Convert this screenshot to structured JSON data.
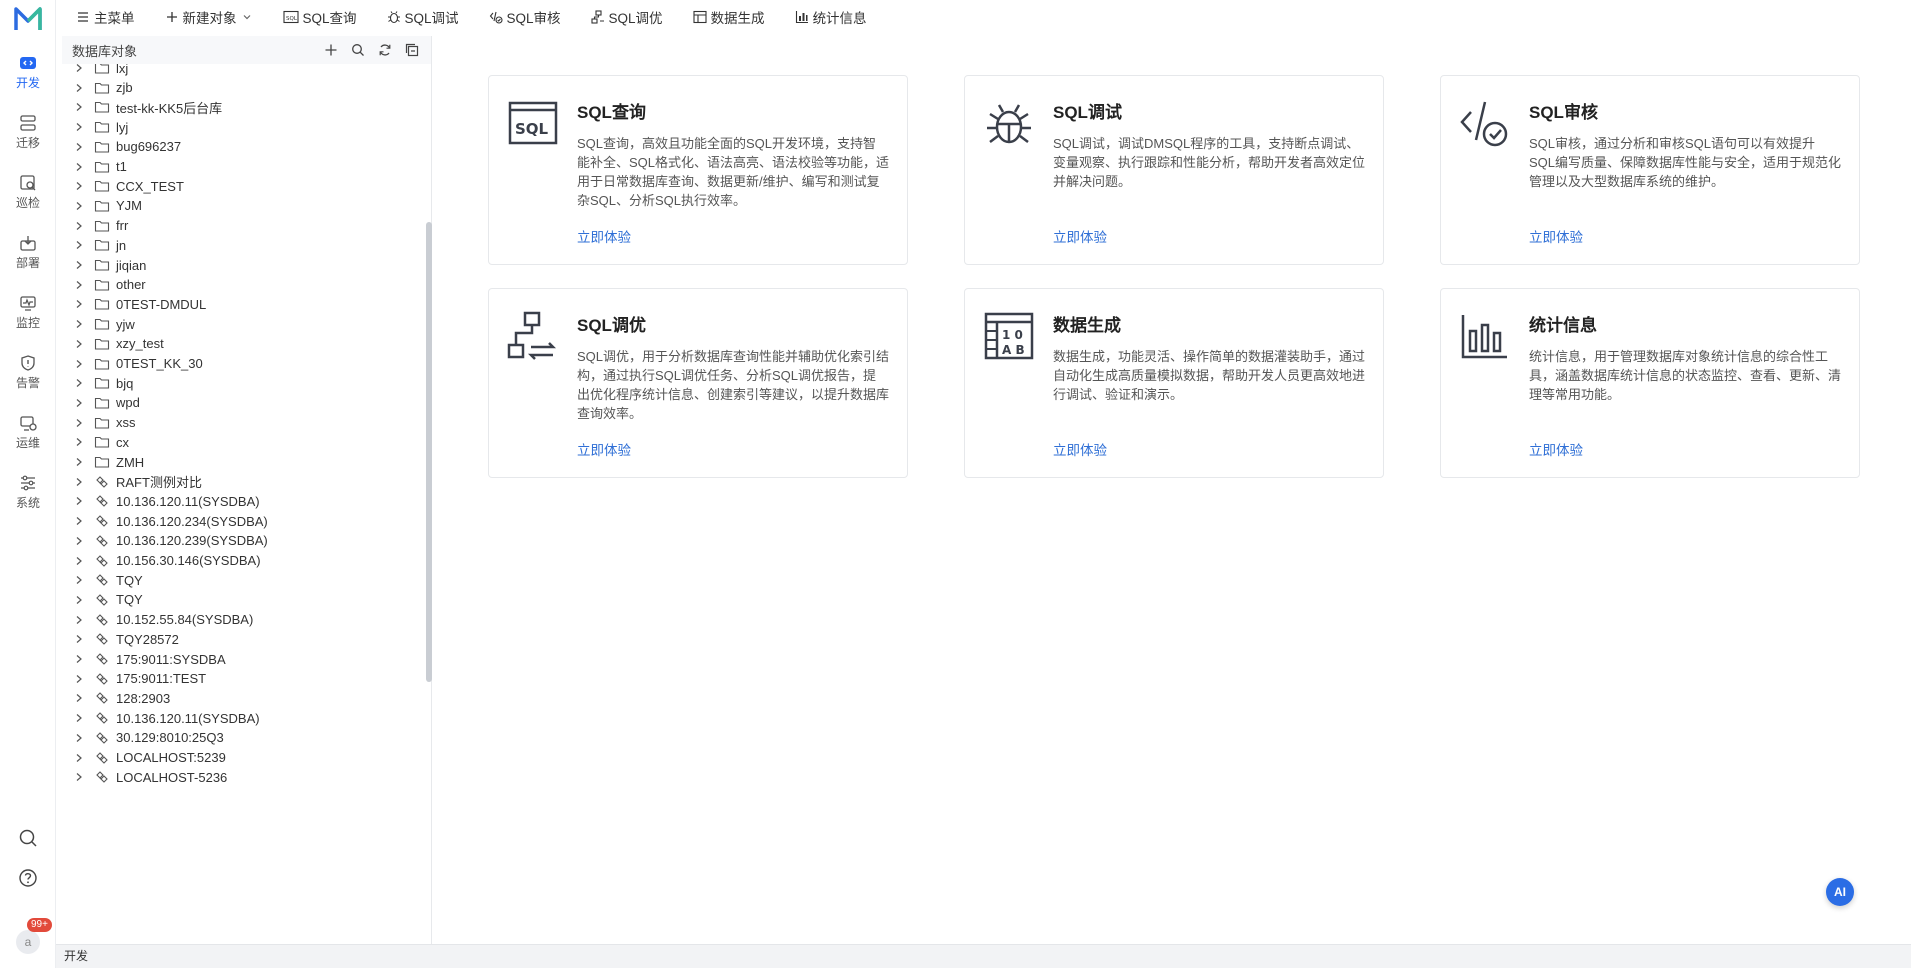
{
  "colors": {
    "accent": "#2468f2",
    "link": "#2f6fd6",
    "badge": "#e24a3b"
  },
  "rail": {
    "items": [
      {
        "label": "开发",
        "icon": "code-icon",
        "active": true
      },
      {
        "label": "迁移",
        "icon": "migrate-icon"
      },
      {
        "label": "巡检",
        "icon": "inspect-icon"
      },
      {
        "label": "部署",
        "icon": "deploy-icon"
      },
      {
        "label": "监控",
        "icon": "monitor-icon"
      },
      {
        "label": "告警",
        "icon": "alert-icon"
      },
      {
        "label": "运维",
        "icon": "ops-icon"
      },
      {
        "label": "系统",
        "icon": "system-icon"
      }
    ],
    "avatar": "a",
    "badge": "99+"
  },
  "toolbar": {
    "items": [
      {
        "label": "主菜单",
        "icon": "menu-icon"
      },
      {
        "label": "新建对象",
        "icon": "plus-icon"
      },
      {
        "label": "SQL查询",
        "icon": "sql-icon"
      },
      {
        "label": "SQL调试",
        "icon": "bug-icon"
      },
      {
        "label": "SQL审核",
        "icon": "audit-icon"
      },
      {
        "label": "SQL调优",
        "icon": "tune-icon"
      },
      {
        "label": "数据生成",
        "icon": "table-icon"
      },
      {
        "label": "统计信息",
        "icon": "bar-chart-icon"
      }
    ]
  },
  "tree": {
    "title": "数据库对象",
    "rows": [
      {
        "label": "lxj",
        "type": "folder"
      },
      {
        "label": "zjb",
        "type": "folder"
      },
      {
        "label": "test-kk-KK5后台库",
        "type": "folder"
      },
      {
        "label": "lyj",
        "type": "folder"
      },
      {
        "label": "bug696237",
        "type": "folder"
      },
      {
        "label": "t1",
        "type": "folder"
      },
      {
        "label": "CCX_TEST",
        "type": "folder"
      },
      {
        "label": "YJM",
        "type": "folder"
      },
      {
        "label": "frr",
        "type": "folder"
      },
      {
        "label": "jn",
        "type": "folder"
      },
      {
        "label": "jiqian",
        "type": "folder"
      },
      {
        "label": "other",
        "type": "folder"
      },
      {
        "label": "0TEST-DMDUL",
        "type": "folder"
      },
      {
        "label": "yjw",
        "type": "folder"
      },
      {
        "label": "xzy_test",
        "type": "folder"
      },
      {
        "label": "0TEST_KK_30",
        "type": "folder"
      },
      {
        "label": "bjq",
        "type": "folder"
      },
      {
        "label": "wpd",
        "type": "folder"
      },
      {
        "label": "xss",
        "type": "folder"
      },
      {
        "label": "cx",
        "type": "folder"
      },
      {
        "label": "ZMH",
        "type": "folder"
      },
      {
        "label": "RAFT测例对比",
        "type": "conn"
      },
      {
        "label": "10.136.120.11(SYSDBA)",
        "type": "conn"
      },
      {
        "label": "10.136.120.234(SYSDBA)",
        "type": "conn"
      },
      {
        "label": "10.136.120.239(SYSDBA)",
        "type": "conn"
      },
      {
        "label": "10.156.30.146(SYSDBA)",
        "type": "conn"
      },
      {
        "label": "TQY",
        "type": "conn"
      },
      {
        "label": "TQY",
        "type": "conn"
      },
      {
        "label": "10.152.55.84(SYSDBA)",
        "type": "conn"
      },
      {
        "label": "TQY28572",
        "type": "conn"
      },
      {
        "label": "175:9011:SYSDBA",
        "type": "conn"
      },
      {
        "label": "175:9011:TEST",
        "type": "conn"
      },
      {
        "label": "128:2903",
        "type": "conn"
      },
      {
        "label": "10.136.120.11(SYSDBA)",
        "type": "conn"
      },
      {
        "label": "30.129:8010:25Q3",
        "type": "conn"
      },
      {
        "label": "LOCALHOST:5239",
        "type": "conn"
      },
      {
        "label": "LOCALHOST-5236",
        "type": "conn"
      }
    ]
  },
  "cards": [
    {
      "title": "SQL查询",
      "icon": "sql-window-icon",
      "desc": "SQL查询，高效且功能全面的SQL开发环境，支持智能补全、SQL格式化、语法高亮、语法校验等功能，适用于日常数据库查询、数据更新/维护、编写和测试复杂SQL、分析SQL执行效率。",
      "link": "立即体验"
    },
    {
      "title": "SQL调试",
      "icon": "bug-icon",
      "desc": "SQL调试，调试DMSQL程序的工具，支持断点调试、变量观察、执行跟踪和性能分析，帮助开发者高效定位并解决问题。",
      "link": "立即体验"
    },
    {
      "title": "SQL审核",
      "icon": "code-check-icon",
      "desc": "SQL审核，通过分析和审核SQL语句可以有效提升SQL编写质量、保障数据库性能与安全，适用于规范化管理以及大型数据库系统的维护。",
      "link": "立即体验"
    },
    {
      "title": "SQL调优",
      "icon": "flow-icon",
      "desc": "SQL调优，用于分析数据库查询性能并辅助优化索引结构，通过执行SQL调优任务、分析SQL调优报告，提出优化程序统计信息、创建索引等建议，以提升数据库查询效率。",
      "link": "立即体验"
    },
    {
      "title": "数据生成",
      "icon": "data-gen-icon",
      "desc": "数据生成，功能灵活、操作简单的数据灌装助手，通过自动化生成高质量模拟数据，帮助开发人员更高效地进行调试、验证和演示。",
      "link": "立即体验"
    },
    {
      "title": "统计信息",
      "icon": "bar-chart-icon",
      "desc": "统计信息，用于管理数据库对象统计信息的综合性工具，涵盖数据库统计信息的状态监控、查看、更新、清理等常用功能。",
      "link": "立即体验"
    }
  ],
  "statusbar": {
    "text": "开发"
  },
  "ai_button": "AI"
}
